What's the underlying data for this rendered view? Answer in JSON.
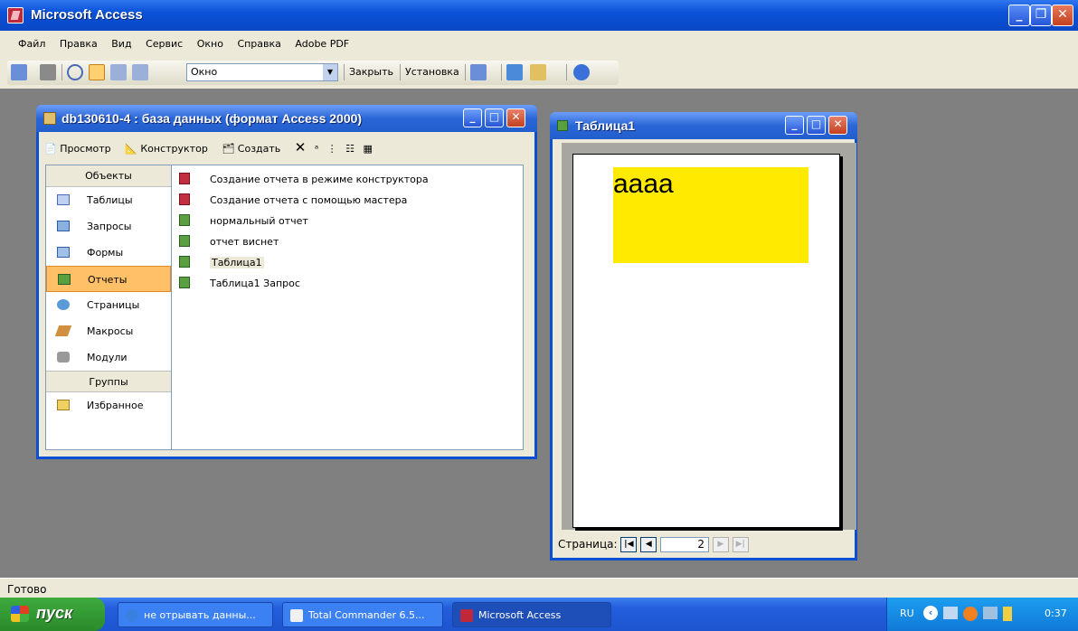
{
  "app": {
    "title": "Microsoft Access"
  },
  "menu": [
    "Файл",
    "Правка",
    "Вид",
    "Сервис",
    "Окно",
    "Справка",
    "Adobe PDF"
  ],
  "toolbar": {
    "combo_value": "Окно",
    "close_label": "Закрыть",
    "setup_label": "Установка"
  },
  "db_window": {
    "title": "db130610-4 : база данных (формат Access 2000)",
    "toolbar": {
      "preview": "Просмотр",
      "designer": "Конструктор",
      "create": "Создать"
    },
    "objects_header": "Объекты",
    "objects": [
      "Таблицы",
      "Запросы",
      "Формы",
      "Отчеты",
      "Страницы",
      "Макросы",
      "Модули"
    ],
    "selected_object": "Отчеты",
    "groups_header": "Группы",
    "groups": [
      "Избранное"
    ],
    "items": [
      {
        "label": "Создание отчета в режиме конструктора",
        "icon": "wizard-icon"
      },
      {
        "label": "Создание отчета с помощью мастера",
        "icon": "wizard-icon"
      },
      {
        "label": "нормальный отчет",
        "icon": "report-icon"
      },
      {
        "label": "отчет виснет",
        "icon": "report-icon"
      },
      {
        "label": "Таблица1",
        "icon": "report-icon"
      },
      {
        "label": "Таблица1 Запрос",
        "icon": "report-icon"
      }
    ]
  },
  "report_window": {
    "title": "Таблица1",
    "content_text": "aaaa",
    "nav_label": "Страница:",
    "page_number": "2"
  },
  "status": {
    "text": "Готово"
  },
  "taskbar": {
    "start_label": "пуск",
    "tasks": [
      "не отрывать данны...",
      "Total Commander 6.5...",
      "Microsoft Access"
    ],
    "lang": "RU",
    "clock": "0:37"
  },
  "colors": {
    "accent": "#0a52d8",
    "highlight": "#ffea00",
    "selected": "#ffc068"
  }
}
